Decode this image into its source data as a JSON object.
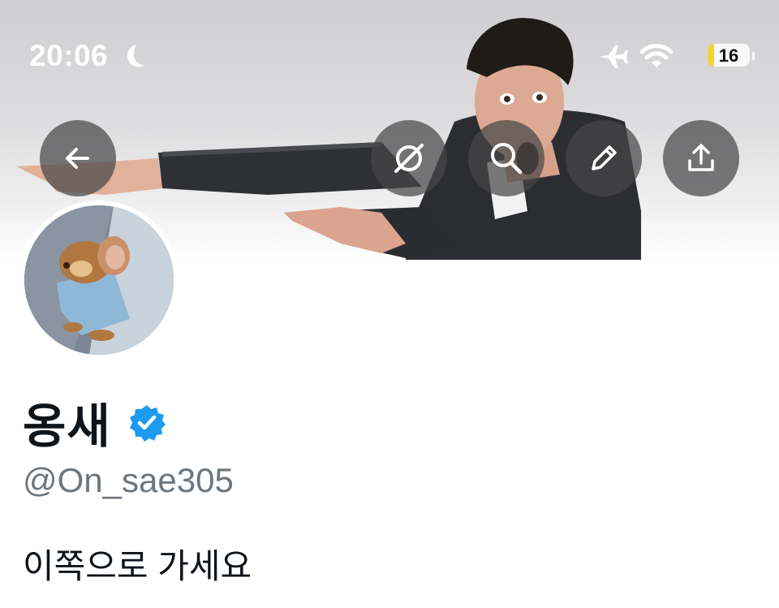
{
  "status_bar": {
    "time": "20:06",
    "battery": "16",
    "icons": [
      "moon-icon",
      "airplane-icon",
      "wifi-icon",
      "battery-icon"
    ]
  },
  "header": {
    "buttons": [
      "back-arrow-icon",
      "grok-icon",
      "search-icon",
      "edit-pencil-icon",
      "share-icon"
    ]
  },
  "profile": {
    "display_name": "옹새",
    "verified": true,
    "handle": "@On_sae305",
    "bio": "이쪽으로 가세요"
  },
  "colors": {
    "verified_badge": "#1d9bf0",
    "handle_text": "#6e767d",
    "primary_text": "#0f1419",
    "button_bg": "rgba(70,70,72,0.72)"
  }
}
